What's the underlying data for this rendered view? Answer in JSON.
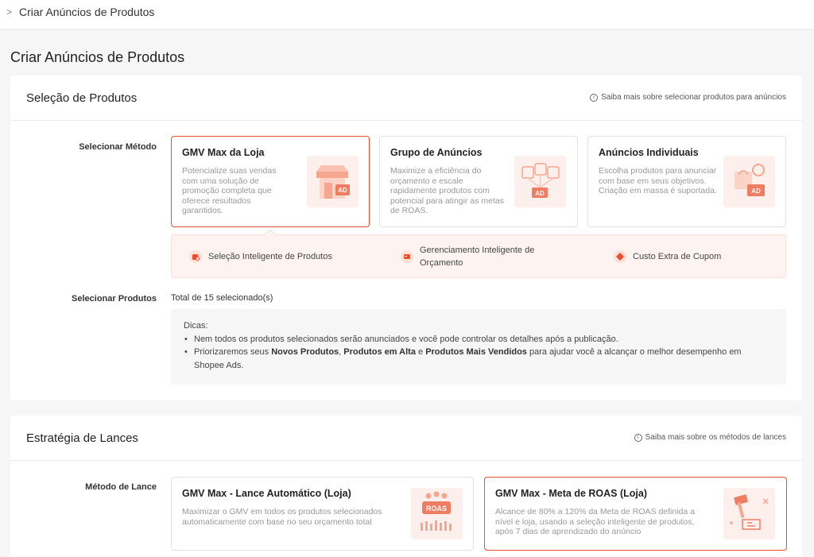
{
  "breadcrumb": {
    "current": "Criar Anúncios de Produtos"
  },
  "page": {
    "title": "Criar Anúncios de Produtos"
  },
  "product_selection": {
    "title": "Seleção de Produtos",
    "help_link": "Saiba mais sobre selecionar produtos para anúncios",
    "method_label": "Selecionar Método",
    "methods": [
      {
        "title": "GMV Max da Loja",
        "description": "Potencialize suas vendas com uma solução de promoção completa que oferece resultados garantidos.",
        "icon": "store-ad-icon",
        "selected": true
      },
      {
        "title": "Grupo de Anúncios",
        "description": "Maximize a eficiência do orçamento e escale rapidamente produtos com potencial para atingir as metas de ROAS.",
        "icon": "ad-group-bags-icon",
        "selected": false
      },
      {
        "title": "Anúncios Individuais",
        "description": "Escolha produtos para anunciar com base em seus objetivos. Criação em massa é suportada.",
        "icon": "individual-ad-icon",
        "selected": false
      }
    ],
    "features": [
      {
        "label": "Seleção Inteligente de Produtos",
        "icon": "smart-product-icon"
      },
      {
        "label": "Gerenciamento Inteligente de Orçamento",
        "icon": "smart-budget-icon"
      },
      {
        "label": "Custo Extra de Cupom",
        "icon": "coupon-icon"
      }
    ],
    "products_label": "Selecionar Produtos",
    "total_selected": "Total de 15 selecionado(s)",
    "tips": {
      "heading": "Dicas:",
      "tip1": "Nem todos os produtos selecionados serão anunciados e você pode controlar os detalhes após a publicação.",
      "tip2_prefix": "Priorizaremos seus ",
      "tip2_bold1": "Novos Produtos",
      "tip2_sep1": ", ",
      "tip2_bold2": "Produtos em Alta",
      "tip2_sep2": " e ",
      "tip2_bold3": "Produtos Mais Vendidos",
      "tip2_suffix": " para ajudar você a alcançar o melhor desempenho em Shopee Ads."
    }
  },
  "bidding_strategy": {
    "title": "Estratégia de Lances",
    "help_link": "Saiba mais sobre os métodos de lances",
    "method_label": "Método de Lance",
    "methods": [
      {
        "title": "GMV Max - Lance Automático (Loja)",
        "description": "Maximizar o GMV em todos os produtos selecionados automaticamente com base no seu orçamento total",
        "icon": "roas-chart-icon",
        "badge": "ROAS",
        "selected": false
      },
      {
        "title": "GMV Max - Meta de ROAS (Loja)",
        "description": "Alcance de 80% a 120% da Meta de ROAS definida a nível e loja, usando a seleção inteligente de produtos, após 7 dias de aprendizado do anúncio",
        "icon": "target-hammer-icon",
        "selected": true
      }
    ]
  },
  "colors": {
    "accent": "#ee4d2d",
    "illustration_bg": "#fdf0ec",
    "feature_bg": "#fdf4f1"
  }
}
